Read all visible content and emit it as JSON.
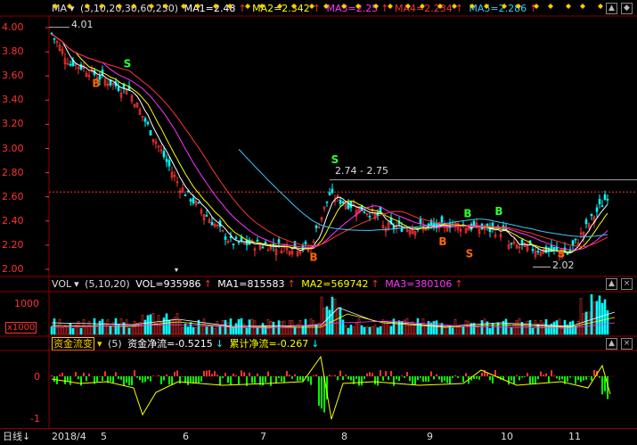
{
  "price_panel": {
    "indicator_name": "MA",
    "params": "(5,10,20,30,60,250)",
    "values": [
      {
        "label": "MA1=2.48",
        "color": "#ffffff"
      },
      {
        "label": "MA2=2.342",
        "color": "#ffff00"
      },
      {
        "label": "MA3=2.25",
        "color": "#ff33ff"
      },
      {
        "label": "MA4=2.234",
        "color": "#ff3333"
      },
      {
        "label": "MA5=2.286",
        "color": "#33ccff"
      }
    ],
    "y_ticks": [
      "4.00",
      "3.80",
      "3.60",
      "3.40",
      "3.20",
      "3.00",
      "2.80",
      "2.60",
      "2.40",
      "2.20",
      "2.00"
    ],
    "annotations": {
      "high": "4.01",
      "range": "2.74 - 2.75",
      "low": "2.02"
    },
    "signals": [
      "B",
      "S",
      "B",
      "S",
      "B",
      "B",
      "S",
      "B",
      "S",
      "B"
    ]
  },
  "vol_panel": {
    "indicator_name": "VOL",
    "params": "(5,10,20)",
    "vol_label": "VOL=935986",
    "ma_labels": [
      {
        "label": "MA1=815583",
        "color": "#ffffff"
      },
      {
        "label": "MA2=569742",
        "color": "#ffff00"
      },
      {
        "label": "MA3=380106",
        "color": "#ff33ff"
      }
    ],
    "y_tick": "1000",
    "unit": "x1000"
  },
  "flow_panel": {
    "indicator_name": "资金流变",
    "params": "(5)",
    "net_label": "资金净流=-0.5215",
    "cum_label": "累计净流=-0.267",
    "y_ticks": [
      "0",
      "-1"
    ]
  },
  "bottom": {
    "period": "日线",
    "x_labels": [
      "2018/4",
      "5",
      "6",
      "7",
      "8",
      "9",
      "10",
      "11"
    ]
  },
  "colors": {
    "up": "#ff3333",
    "down": "#00ffff",
    "grid": "#8b0000"
  }
}
